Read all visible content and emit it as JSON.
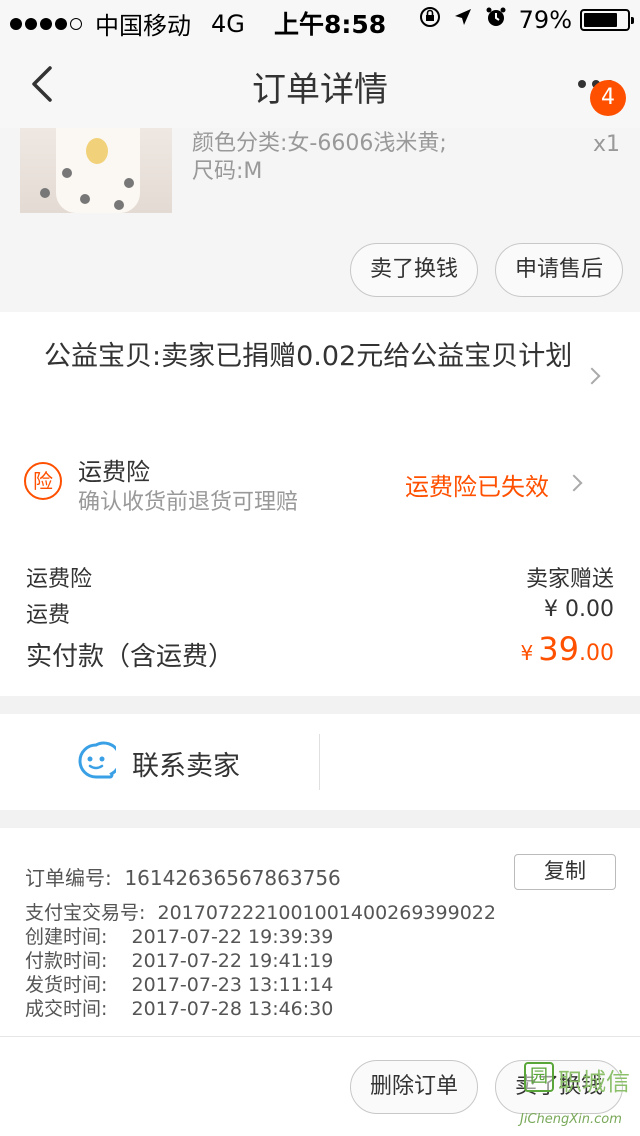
{
  "status_bar": {
    "carrier": "中国移动",
    "network": "4G",
    "time": "上午8:58",
    "battery": "79%"
  },
  "nav": {
    "title": "订单详情",
    "badge": "4"
  },
  "product": {
    "spec_line1": "颜色分类:女-6606浅米黄;",
    "spec_line2": "尺码:M",
    "quantity": "x1",
    "sell_button": "卖了换钱",
    "aftersale_button": "申请售后"
  },
  "charity": {
    "text": "公益宝贝:卖家已捐赠0.02元给公益宝贝计划"
  },
  "insurance": {
    "icon_text": "险",
    "title": "运费险",
    "description": "确认收货前退货可理赔",
    "status": "运费险已失效"
  },
  "costs": {
    "insurance_label": "运费险",
    "insurance_value": "卖家赠送",
    "shipping_label": "运费",
    "shipping_value": "¥ 0.00",
    "total_label": "实付款（含运费）",
    "total_currency": "¥",
    "total_int": "39",
    "total_dec": ".00"
  },
  "contact": {
    "label": "联系卖家"
  },
  "order_info": {
    "order_no": "订单编号:  16142636567863756",
    "copy_button": "复制",
    "alipay_no": "支付宝交易号:  2017072221001001400269399022",
    "created": "创建时间:    2017-07-22 19:39:39",
    "paid": "付款时间:    2017-07-22 19:41:19",
    "shipped": "发货时间:    2017-07-23 13:11:14",
    "completed": "成交时间:    2017-07-28 13:46:30"
  },
  "footer": {
    "delete_button": "删除订单",
    "sell_button": "卖了换钱"
  },
  "watermark": {
    "char": "园",
    "text": "职城信",
    "url": "JiChengXin.com"
  }
}
